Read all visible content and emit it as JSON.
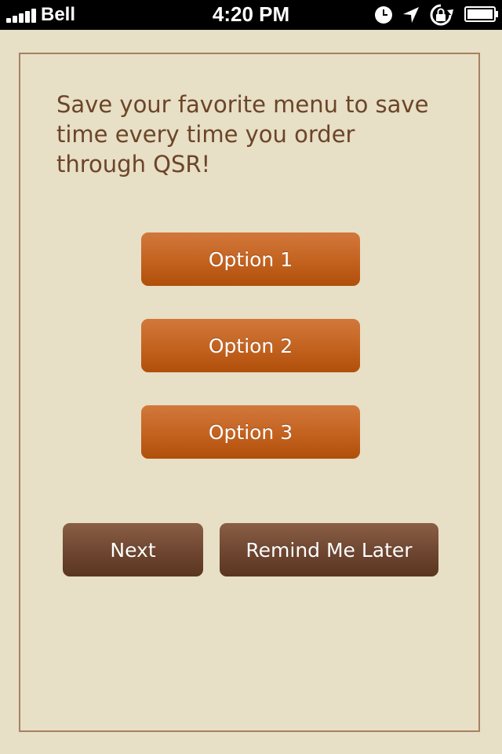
{
  "status_bar": {
    "carrier": "Bell",
    "time": "4:20 PM",
    "icons": [
      "signal-icon",
      "clock-icon",
      "location-icon",
      "rotation-lock-icon",
      "battery-icon"
    ]
  },
  "prompt": {
    "line1": "Save your favorite menu to save",
    "line2": "time every time you order",
    "line3": "through QSR!"
  },
  "options": {
    "option1": "Option 1",
    "option2": "Option 2",
    "option3": "Option 3"
  },
  "actions": {
    "next": "Next",
    "remind_later": "Remind Me Later"
  },
  "colors": {
    "background": "#e7dfc6",
    "card_border": "#a78062",
    "text": "#6b4528",
    "option_button": "#c3621f",
    "action_button": "#6e4530"
  }
}
